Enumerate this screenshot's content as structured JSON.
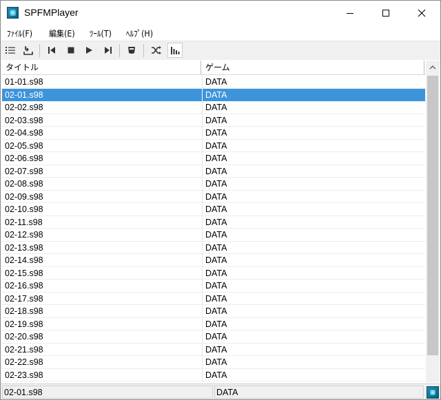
{
  "window": {
    "title": "SPFMPlayer",
    "icon": "spfm-app-icon"
  },
  "menu": {
    "file": "ﾌｧｲﾙ(F)",
    "edit": "編集(E)",
    "tools": "ﾂｰﾙ(T)",
    "help": "ﾍﾙﾌﾟ(H)"
  },
  "toolbar": {
    "buttons": [
      {
        "icon": "playlist-icon"
      },
      {
        "icon": "load-icon"
      },
      {
        "icon": "previous-icon"
      },
      {
        "icon": "stop-icon"
      },
      {
        "icon": "play-icon"
      },
      {
        "icon": "next-icon"
      },
      {
        "icon": "device-icon"
      },
      {
        "icon": "shuffle-icon"
      },
      {
        "icon": "spectrum-icon",
        "pressed": true
      }
    ]
  },
  "list": {
    "columns": [
      "タイトル",
      "ゲーム"
    ],
    "selected_index": 1,
    "rows": [
      {
        "title": "01-01.s98",
        "game": "DATA"
      },
      {
        "title": "02-01.s98",
        "game": "DATA"
      },
      {
        "title": "02-02.s98",
        "game": "DATA"
      },
      {
        "title": "02-03.s98",
        "game": "DATA"
      },
      {
        "title": "02-04.s98",
        "game": "DATA"
      },
      {
        "title": "02-05.s98",
        "game": "DATA"
      },
      {
        "title": "02-06.s98",
        "game": "DATA"
      },
      {
        "title": "02-07.s98",
        "game": "DATA"
      },
      {
        "title": "02-08.s98",
        "game": "DATA"
      },
      {
        "title": "02-09.s98",
        "game": "DATA"
      },
      {
        "title": "02-10.s98",
        "game": "DATA"
      },
      {
        "title": "02-11.s98",
        "game": "DATA"
      },
      {
        "title": "02-12.s98",
        "game": "DATA"
      },
      {
        "title": "02-13.s98",
        "game": "DATA"
      },
      {
        "title": "02-14.s98",
        "game": "DATA"
      },
      {
        "title": "02-15.s98",
        "game": "DATA"
      },
      {
        "title": "02-16.s98",
        "game": "DATA"
      },
      {
        "title": "02-17.s98",
        "game": "DATA"
      },
      {
        "title": "02-18.s98",
        "game": "DATA"
      },
      {
        "title": "02-19.s98",
        "game": "DATA"
      },
      {
        "title": "02-20.s98",
        "game": "DATA"
      },
      {
        "title": "02-21.s98",
        "game": "DATA"
      },
      {
        "title": "02-22.s98",
        "game": "DATA"
      },
      {
        "title": "02-23.s98",
        "game": "DATA"
      }
    ]
  },
  "status": {
    "file": "02-01.s98",
    "game": "DATA"
  },
  "colors": {
    "selection": "#3c94db",
    "toolbar_bg": "#f0f0f0",
    "icon_dark": "#333333"
  }
}
